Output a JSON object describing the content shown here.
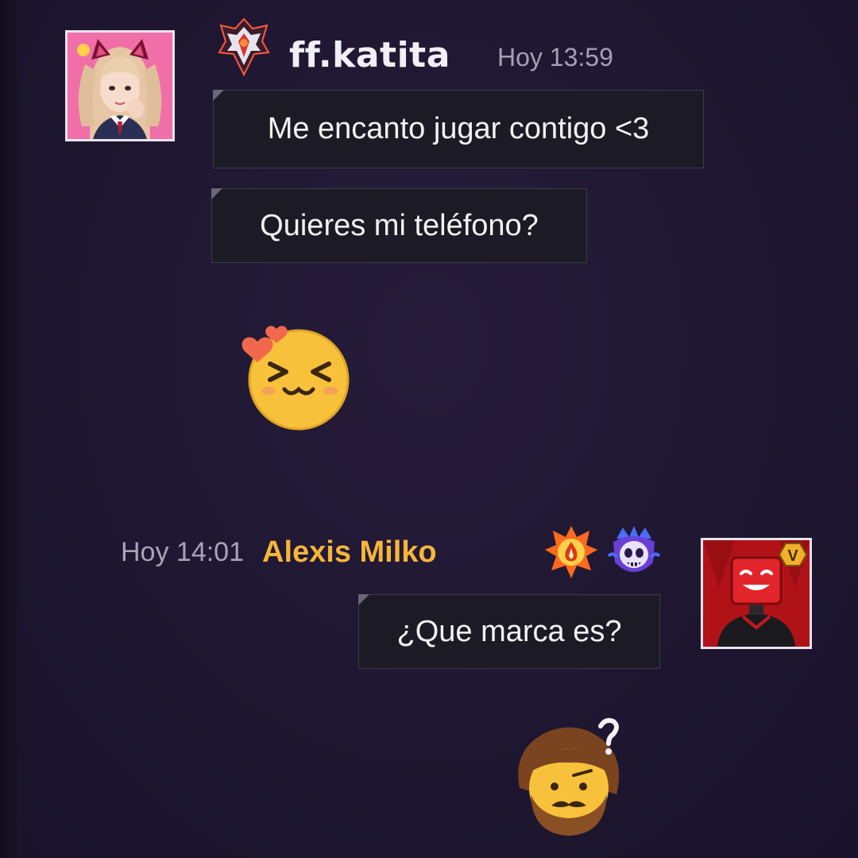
{
  "messages": {
    "katita": {
      "username": "ff.katita",
      "timestamp": "Hoy 13:59",
      "bubbles": [
        "Me encanto jugar contigo <3",
        "Quieres mi teléfono?"
      ],
      "sticker": "blushing-hearts-emoji-icon"
    },
    "alexis": {
      "username": "Alexis Milko",
      "timestamp": "Hoy 14:01",
      "bubbles": [
        "¿Que marca es?"
      ],
      "sticker": "confused-bearded-face-emoji-icon",
      "badge_letter": "V"
    }
  },
  "colors": {
    "background": "#1f1731",
    "bubble": "#1c1b25",
    "katita_name": "#f1eef6",
    "alexis_name": "#f4b53a",
    "timestamp": "#a79fb7"
  }
}
